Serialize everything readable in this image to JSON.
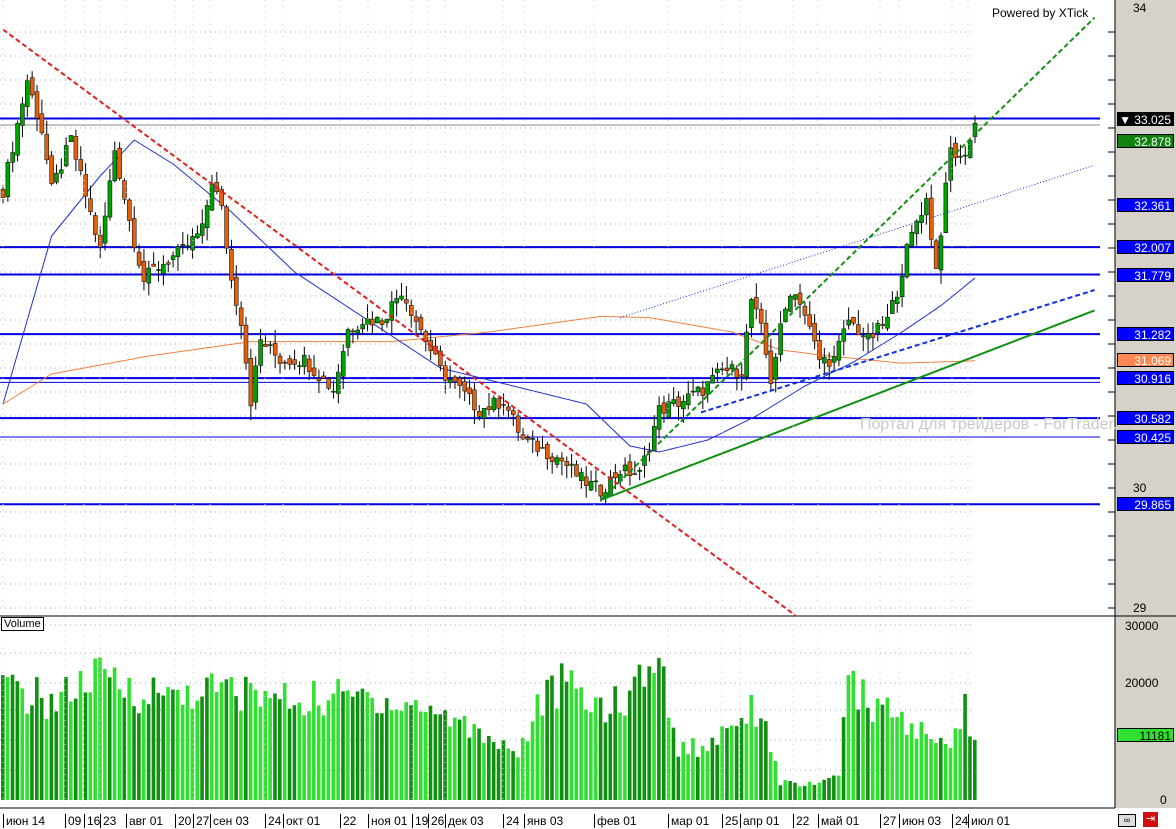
{
  "header": {
    "powered_by": "Powered by XTick",
    "watermark": "Портал для трейдеров - ForTrader.ru",
    "volume_label": "Volume"
  },
  "colors": {
    "bg_axis": "#d6d2ca",
    "level": "#0000e0",
    "up": "#00a000",
    "down": "#e06010",
    "ma_fast": "#2030d0",
    "ma_slow": "#f08040",
    "vol_light": "#30e030",
    "vol_dark": "#109010",
    "trend_red": "#e02020",
    "trend_green": "#109010",
    "trend_blue": "#1030e0"
  },
  "chart_data": {
    "type": "candlestick",
    "price_axis": {
      "ylim": [
        28.95,
        34.05
      ],
      "tick_labels": [
        "34",
        "30",
        "29"
      ],
      "tick_values": [
        34,
        30,
        29
      ]
    },
    "volume_axis": {
      "ylim": [
        0,
        30000
      ],
      "tick_labels": [
        "30000",
        "20000",
        "0"
      ],
      "tick_values": [
        30000,
        20000,
        0
      ]
    },
    "bars": 201,
    "close_path": [
      [
        0,
        32.48
      ],
      [
        5,
        33.4
      ],
      [
        8,
        32.98
      ],
      [
        10,
        32.48
      ],
      [
        14,
        32.9
      ],
      [
        20,
        31.98
      ],
      [
        23,
        32.82
      ],
      [
        26,
        32.23
      ],
      [
        29,
        31.73
      ],
      [
        31,
        31.82
      ],
      [
        37,
        31.98
      ],
      [
        41,
        32.15
      ],
      [
        43,
        32.57
      ],
      [
        45,
        32.32
      ],
      [
        47,
        31.73
      ],
      [
        49,
        31.4
      ],
      [
        51,
        30.73
      ],
      [
        53,
        31.23
      ],
      [
        57,
        31.07
      ],
      [
        62,
        31.07
      ],
      [
        68,
        30.82
      ],
      [
        71,
        31.32
      ],
      [
        74,
        31.4
      ],
      [
        78,
        31.4
      ],
      [
        82,
        31.65
      ],
      [
        86,
        31.32
      ],
      [
        90,
        30.98
      ],
      [
        94,
        30.82
      ],
      [
        98,
        30.65
      ],
      [
        103,
        30.73
      ],
      [
        107,
        30.4
      ],
      [
        111,
        30.32
      ],
      [
        115,
        30.23
      ],
      [
        119,
        30.07
      ],
      [
        123,
        29.98
      ],
      [
        127,
        30.15
      ],
      [
        131,
        30.11
      ],
      [
        133,
        30.36
      ],
      [
        135,
        30.65
      ],
      [
        140,
        30.73
      ],
      [
        144,
        30.82
      ],
      [
        148,
        30.98
      ],
      [
        152,
        30.98
      ],
      [
        154,
        31.57
      ],
      [
        156,
        31.32
      ],
      [
        158,
        30.9
      ],
      [
        160,
        31.32
      ],
      [
        162,
        31.65
      ],
      [
        164,
        31.57
      ],
      [
        166,
        31.32
      ],
      [
        168,
        31.07
      ],
      [
        171,
        31.07
      ],
      [
        174,
        31.4
      ],
      [
        178,
        31.23
      ],
      [
        182,
        31.4
      ],
      [
        184,
        31.65
      ],
      [
        186,
        31.98
      ],
      [
        188,
        32.23
      ],
      [
        190,
        32.4
      ],
      [
        192,
        31.82
      ],
      [
        193,
        32.15
      ],
      [
        195,
        32.82
      ],
      [
        197,
        32.73
      ],
      [
        199,
        32.9
      ],
      [
        200,
        33.03
      ]
    ],
    "volume_path": [
      [
        0,
        19000
      ],
      [
        10,
        17000
      ],
      [
        20,
        21000
      ],
      [
        30,
        18000
      ],
      [
        45,
        19000
      ],
      [
        60,
        17000
      ],
      [
        75,
        18000
      ],
      [
        90,
        15000
      ],
      [
        100,
        11000
      ],
      [
        106,
        8000
      ],
      [
        110,
        16000
      ],
      [
        115,
        20000
      ],
      [
        120,
        17000
      ],
      [
        128,
        16000
      ],
      [
        133,
        25000
      ],
      [
        136,
        20000
      ],
      [
        139,
        9000
      ],
      [
        145,
        9000
      ],
      [
        150,
        14000
      ],
      [
        156,
        16000
      ],
      [
        160,
        3000
      ],
      [
        168,
        2500
      ],
      [
        172,
        5000
      ],
      [
        174,
        19000
      ],
      [
        180,
        16000
      ],
      [
        186,
        13000
      ],
      [
        194,
        9000
      ],
      [
        198,
        16000
      ],
      [
        200,
        11181
      ]
    ],
    "ma_fast_path": [
      [
        0,
        30.7
      ],
      [
        10,
        32.1
      ],
      [
        20,
        32.6
      ],
      [
        27,
        32.9
      ],
      [
        35,
        32.7
      ],
      [
        47,
        32.3
      ],
      [
        60,
        31.8
      ],
      [
        75,
        31.4
      ],
      [
        90,
        31.0
      ],
      [
        105,
        30.85
      ],
      [
        120,
        30.7
      ],
      [
        129,
        30.35
      ],
      [
        135,
        30.3
      ],
      [
        145,
        30.4
      ],
      [
        155,
        30.6
      ],
      [
        165,
        30.85
      ],
      [
        175,
        31.05
      ],
      [
        185,
        31.3
      ],
      [
        193,
        31.52
      ],
      [
        200,
        31.75
      ]
    ],
    "ma_slow_path": [
      [
        0,
        30.7
      ],
      [
        10,
        30.95
      ],
      [
        30,
        31.1
      ],
      [
        51,
        31.22
      ],
      [
        80,
        31.22
      ],
      [
        100,
        31.3
      ],
      [
        123,
        31.43
      ],
      [
        133,
        31.42
      ],
      [
        150,
        31.3
      ],
      [
        160,
        31.15
      ],
      [
        170,
        31.1
      ],
      [
        185,
        31.04
      ],
      [
        200,
        31.06
      ]
    ],
    "levels": [
      33.079,
      32.007,
      31.779,
      31.282,
      30.916,
      30.582,
      29.865
    ],
    "thin_levels": [
      33.025,
      30.425,
      30.88
    ],
    "trendlines": [
      {
        "name": "red-dashed",
        "from": [
          0,
          33.82
        ],
        "to": [
          163,
          28.94
        ],
        "style": "dashed",
        "color": "trend_red"
      },
      {
        "name": "green-dashed",
        "from": [
          123,
          29.9
        ],
        "to": [
          224.6,
          33.92
        ],
        "style": "dashed",
        "color": "trend_green"
      },
      {
        "name": "green-solid",
        "from": [
          123,
          29.9
        ],
        "to": [
          224.6,
          31.48
        ],
        "style": "solid",
        "color": "trend_green"
      },
      {
        "name": "blue-dashed",
        "from": [
          143.6,
          30.63
        ],
        "to": [
          224.6,
          31.65
        ],
        "style": "dashed",
        "color": "trend_blue"
      },
      {
        "name": "blue-dotted",
        "from": [
          127,
          31.42
        ],
        "to": [
          224.6,
          32.69
        ],
        "style": "dotted",
        "color": "trend_blue"
      }
    ],
    "price_labels": [
      {
        "text": "33.025",
        "bg": "#000000",
        "marker": "▼"
      },
      {
        "text": "32.878",
        "bg": "#108010"
      },
      {
        "text": "32.361",
        "bg": "#0000ff"
      },
      {
        "text": "32.007",
        "bg": "#0000ff"
      },
      {
        "text": "31.779",
        "bg": "#0000ff"
      },
      {
        "text": "31.282",
        "bg": "#0000ff"
      },
      {
        "text": "31.069",
        "bg": "#ff8850"
      },
      {
        "text": "30.916",
        "bg": "#0000ff"
      },
      {
        "text": "30.582",
        "bg": "#0000ff"
      },
      {
        "text": "30.425",
        "bg": "#0000ff"
      },
      {
        "text": "29.865",
        "bg": "#0000ff"
      }
    ],
    "volume_label": {
      "text": "11181",
      "bg": "#30e030"
    },
    "date_labels": [
      "июн 14",
      "09",
      "16",
      "23",
      "авг 01",
      "20",
      "27",
      "сен 03",
      "24",
      "окт 01",
      "22",
      "ноя 01",
      "19",
      "26",
      "дек 03",
      "24",
      "янв 03",
      "фев 01",
      "мар 01",
      "25",
      "апр 01",
      "22",
      "май 01",
      "27",
      "июн 03",
      "24",
      "июл 01"
    ]
  }
}
